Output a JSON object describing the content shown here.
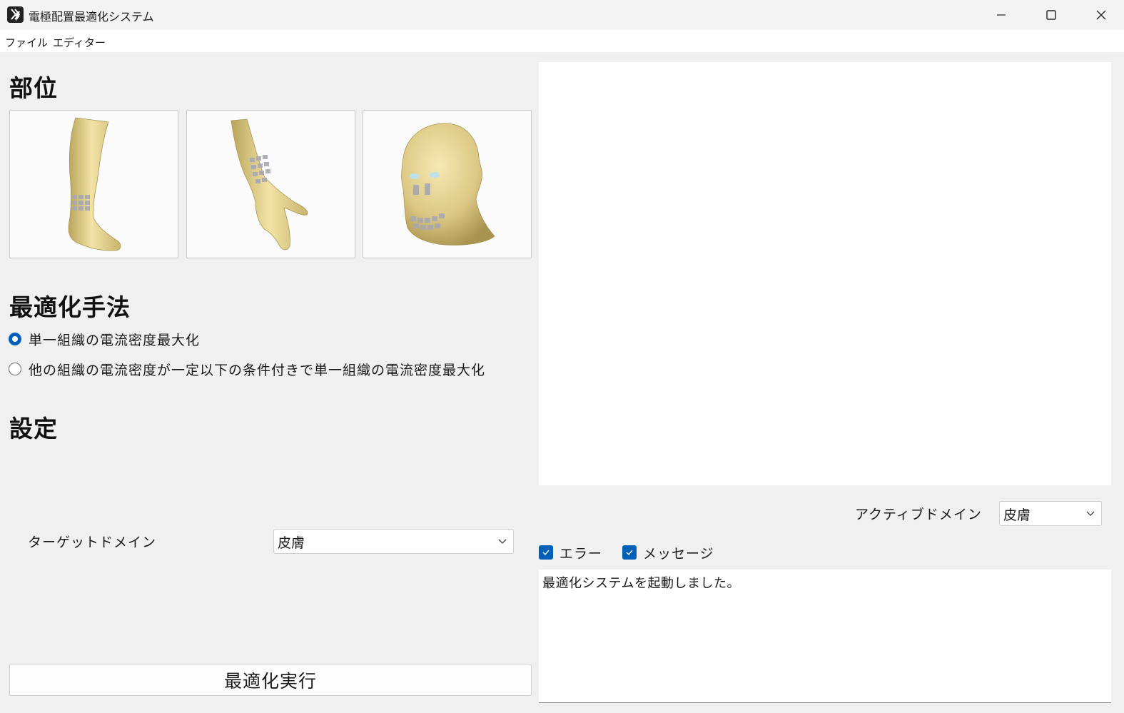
{
  "window": {
    "title": "電極配置最適化システム",
    "controls": {
      "minimize": "minimize",
      "maximize": "maximize",
      "close": "close"
    }
  },
  "menu": {
    "items": [
      {
        "label": "ファイル"
      },
      {
        "label": "エディター"
      }
    ]
  },
  "body_part": {
    "heading": "部位",
    "options": [
      {
        "icon": "leg-model-icon"
      },
      {
        "icon": "arm-model-icon"
      },
      {
        "icon": "head-model-icon"
      }
    ]
  },
  "method": {
    "heading": "最適化手法",
    "options": [
      {
        "label": "単一組織の電流密度最大化",
        "selected": true
      },
      {
        "label": "他の組織の電流密度が一定以下の条件付きで単一組織の電流密度最大化",
        "selected": false
      }
    ]
  },
  "settings": {
    "heading": "設定",
    "target_domain": {
      "label": "ターゲットドメイン",
      "value": "皮膚"
    }
  },
  "run_button": {
    "label": "最適化実行"
  },
  "viewer": {
    "active_domain": {
      "label": "アクティブドメイン",
      "value": "皮膚"
    }
  },
  "log_filters": {
    "error": {
      "label": "エラー",
      "checked": true
    },
    "message": {
      "label": "メッセージ",
      "checked": true
    }
  },
  "log": {
    "text": "最適化システムを起動しました。"
  },
  "colors": {
    "accent": "#005fb8",
    "model_skin": "#e6d493",
    "electrode": "#a8a8b0"
  }
}
